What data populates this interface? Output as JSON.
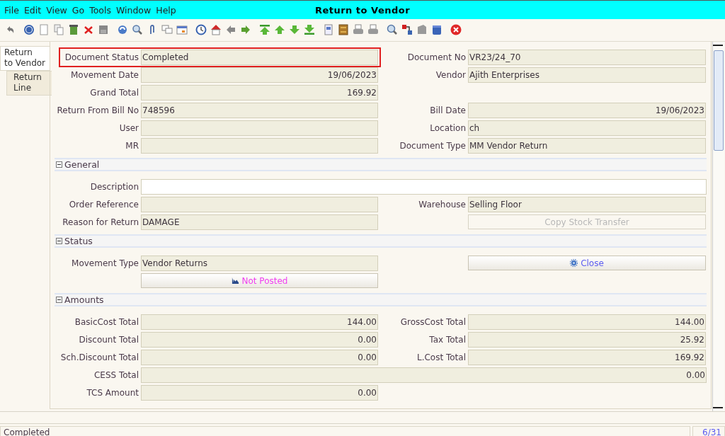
{
  "window": {
    "title": "Return to Vendor"
  },
  "menu": [
    "File",
    "Edit",
    "View",
    "Go",
    "Tools",
    "Window",
    "Help"
  ],
  "tabs": [
    {
      "label": "Return\nto Vendor",
      "selected": true
    },
    {
      "label": "Return\nLine",
      "selected": false
    }
  ],
  "form": {
    "rows": [
      {
        "left": {
          "kind": "text_field",
          "label": "Document Status",
          "value": "Completed",
          "editable": false,
          "highlighted": true
        },
        "right": {
          "kind": "text_field",
          "label": "Document No",
          "value": "VR23/24_70",
          "editable": false
        }
      },
      {
        "left": {
          "kind": "numeric_field",
          "label": "Movement Date",
          "value": "19/06/2023",
          "editable": false
        },
        "right": {
          "kind": "text_field",
          "label": "Vendor",
          "value": "Ajith Enterprises",
          "editable": false
        }
      },
      {
        "left": {
          "kind": "numeric_field",
          "label": "Grand Total",
          "value": "169.92",
          "editable": false
        }
      },
      {
        "left": {
          "kind": "text_field",
          "label": "Return From Bill No",
          "value": "748596",
          "editable": false
        },
        "right": {
          "kind": "numeric_field",
          "label": "Bill Date",
          "value": "19/06/2023",
          "editable": false
        }
      },
      {
        "left": {
          "kind": "text_field",
          "label": "User",
          "editable": false
        },
        "right": {
          "kind": "text_field",
          "label": "Location",
          "value": "ch",
          "editable": false
        }
      },
      {
        "left": {
          "kind": "text_field",
          "label": "MR",
          "editable": false
        },
        "right": {
          "kind": "text_field",
          "label": "Document Type",
          "value": "MM Vendor Return",
          "editable": false
        }
      }
    ],
    "sections": [
      {
        "title": "General",
        "expanded": true,
        "rows": [
          {
            "left": {
              "kind": "wide_text_field",
              "label": "Description",
              "editable": true
            }
          },
          {
            "left": {
              "kind": "text_field",
              "label": "Order Reference",
              "editable": false
            },
            "right": {
              "kind": "text_field",
              "label": "Warehouse",
              "value": "Selling Floor",
              "editable": false
            }
          },
          {
            "left": {
              "kind": "text_field",
              "label": "Reason for Return",
              "value": "DAMAGE",
              "editable": false
            },
            "right": {
              "kind": "button",
              "label": "Copy Stock Transfer",
              "disabled": true,
              "color": "#b8b8b8"
            }
          }
        ]
      },
      {
        "title": "Status",
        "expanded": true,
        "rows": [
          {
            "left": {
              "kind": "text_field",
              "label": "Movement Type",
              "value": "Vendor Returns",
              "editable": false
            },
            "right": {
              "kind": "process_button",
              "label": "Close",
              "disabled": false,
              "color": "#5c5cf0"
            }
          },
          {
            "left": {
              "kind": "posting_button",
              "label": "Not Posted",
              "disabled": false,
              "color": "#f040f0"
            }
          }
        ]
      },
      {
        "title": "Amounts",
        "expanded": true,
        "rows": [
          {
            "left": {
              "kind": "numeric_field",
              "label": "BasicCost Total",
              "value": "144.00",
              "editable": false
            },
            "right": {
              "kind": "numeric_field",
              "label": "GrossCost Total",
              "value": "144.00",
              "editable": false
            }
          },
          {
            "left": {
              "kind": "numeric_field",
              "label": "Discount Total",
              "value": "0.00",
              "editable": false
            },
            "right": {
              "kind": "numeric_field",
              "label": "Tax Total",
              "value": "25.92",
              "editable": false
            }
          },
          {
            "left": {
              "kind": "numeric_field",
              "label": "Sch.Discount Total",
              "value": "0.00",
              "editable": false
            },
            "right": {
              "kind": "numeric_field",
              "label": "L.Cost Total",
              "value": "169.92",
              "editable": false
            }
          },
          {
            "left": {
              "kind": "wide_numeric_field",
              "label": "CESS Total",
              "value": "0.00",
              "editable": false
            }
          },
          {
            "left": {
              "kind": "numeric_field",
              "label": "TCS Amount",
              "value": "0.00",
              "editable": false
            }
          }
        ]
      }
    ]
  },
  "status_bar": {
    "message": "Completed",
    "record": "6/31"
  }
}
